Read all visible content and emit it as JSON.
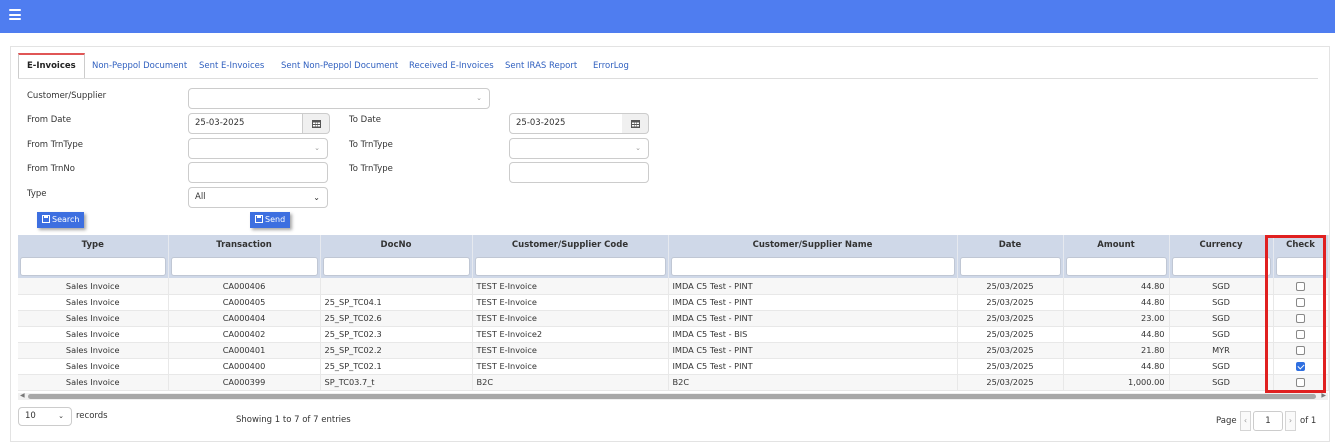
{
  "colors": {
    "topbar": "#4f7df0",
    "accent": "#3d6fe0",
    "highlight": "#e02020"
  },
  "tabs": [
    "E-Invoices",
    "Non-Peppol Document",
    "Sent E-Invoices",
    "Sent Non-Peppol Document",
    "Received E-Invoices",
    "Sent IRAS Report",
    "ErrorLog"
  ],
  "active_tab": "E-Invoices",
  "form": {
    "customer_label": "Customer/Supplier",
    "customer_value": "",
    "from_date_label": "From Date",
    "from_date_value": "25-03-2025",
    "to_date_label": "To Date",
    "to_date_value": "25-03-2025",
    "from_trntype_label": "From TrnType",
    "to_trntype_label_1": "To TrnType",
    "from_trnno_label": "From TrnNo",
    "to_trntype_label_2": "To TrnType",
    "type_label": "Type",
    "type_value": "All"
  },
  "buttons": {
    "search": "Search",
    "send": "Send"
  },
  "table": {
    "headers": [
      "Type",
      "Transaction",
      "DocNo",
      "Customer/Supplier Code",
      "Customer/Supplier Name",
      "Date",
      "Amount",
      "Currency",
      "Check"
    ],
    "rows": [
      {
        "type": "Sales Invoice",
        "transaction": "CA000406",
        "docno": "",
        "code": "TEST E-Invoice",
        "name": "IMDA C5 Test - PINT",
        "date": "25/03/2025",
        "amount": "44.80",
        "currency": "SGD",
        "checked": false
      },
      {
        "type": "Sales Invoice",
        "transaction": "CA000405",
        "docno": "25_SP_TC04.1",
        "code": "TEST E-Invoice",
        "name": "IMDA C5 Test - PINT",
        "date": "25/03/2025",
        "amount": "44.80",
        "currency": "SGD",
        "checked": false
      },
      {
        "type": "Sales Invoice",
        "transaction": "CA000404",
        "docno": "25_SP_TC02.6",
        "code": "TEST E-Invoice",
        "name": "IMDA C5 Test - PINT",
        "date": "25/03/2025",
        "amount": "23.00",
        "currency": "SGD",
        "checked": false
      },
      {
        "type": "Sales Invoice",
        "transaction": "CA000402",
        "docno": "25_SP_TC02.3",
        "code": "TEST E-Invoice2",
        "name": "IMDA C5 Test - BIS",
        "date": "25/03/2025",
        "amount": "44.80",
        "currency": "SGD",
        "checked": false
      },
      {
        "type": "Sales Invoice",
        "transaction": "CA000401",
        "docno": "25_SP_TC02.2",
        "code": "TEST E-Invoice",
        "name": "IMDA C5 Test - PINT",
        "date": "25/03/2025",
        "amount": "21.80",
        "currency": "MYR",
        "checked": false
      },
      {
        "type": "Sales Invoice",
        "transaction": "CA000400",
        "docno": "25_SP_TC02.1",
        "code": "TEST E-Invoice",
        "name": "IMDA C5 Test - PINT",
        "date": "25/03/2025",
        "amount": "44.80",
        "currency": "SGD",
        "checked": true
      },
      {
        "type": "Sales Invoice",
        "transaction": "CA000399",
        "docno": "SP_TC03.7_t",
        "code": "B2C",
        "name": "B2C",
        "date": "25/03/2025",
        "amount": "1,000.00",
        "currency": "SGD",
        "checked": false
      }
    ]
  },
  "footer": {
    "page_size": "10",
    "records_label": "records",
    "summary": "Showing 1 to 7 of 7 entries",
    "page_label": "Page",
    "page_value": "1",
    "of_label": "of 1"
  }
}
